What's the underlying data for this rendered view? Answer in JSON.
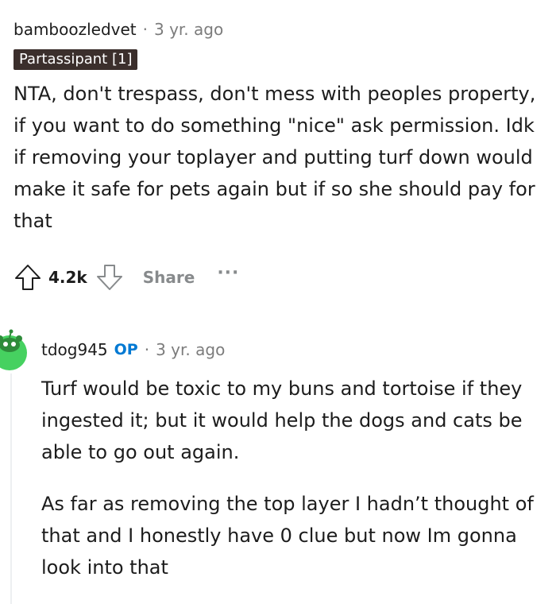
{
  "comment1": {
    "username": "bamboozledvet",
    "separator": "·",
    "time": "3 yr. ago",
    "flair": "Partassipant [1]",
    "body": "NTA, don't trespass, don't mess with peoples property, if you want to do something \"nice\" ask permission. Idk if removing your toplayer and putting turf down would make it safe for pets again but if so she should pay for that",
    "votes": "4.2k",
    "share_label": "Share",
    "more_label": "···"
  },
  "comment2": {
    "username": "tdog945",
    "op_badge": "OP",
    "separator": "·",
    "time": "3 yr. ago",
    "paragraph1": "Turf would be toxic to my buns and tortoise if they ingested it; but it would help the dogs and cats be able to go out again.",
    "paragraph2": "As far as removing the top layer I hadn’t thought of that and I honestly have 0 clue but now Im gonna look into that"
  },
  "colors": {
    "flair_bg": "#3b2f2c",
    "op_blue": "#0079d3",
    "avatar_green": "#46d160",
    "muted_gray": "#7c7c7c"
  }
}
